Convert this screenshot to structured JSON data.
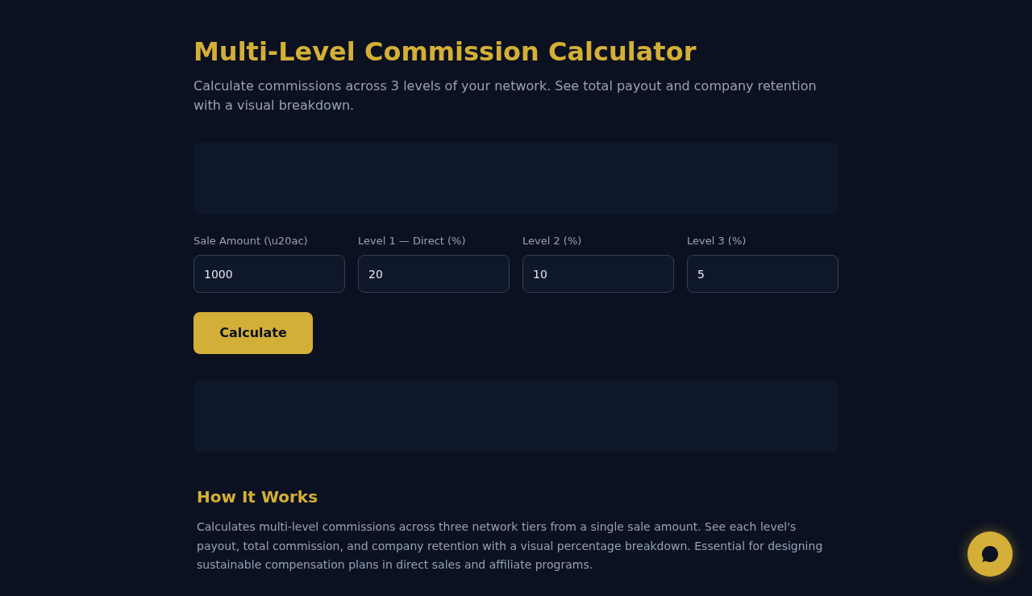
{
  "header": {
    "title": "Multi-Level Commission Calculator",
    "subtitle": "Calculate commissions across 3 levels of your network. See total payout and company retention with a visual breakdown."
  },
  "fields": [
    {
      "label": "Sale Amount (\\u20ac)",
      "value": "1000"
    },
    {
      "label": "Level 1 — Direct (%)",
      "value": "20"
    },
    {
      "label": "Level 2 (%)",
      "value": "10"
    },
    {
      "label": "Level 3 (%)",
      "value": "5"
    }
  ],
  "calculate_button": "Calculate",
  "how_it_works": {
    "heading": "How It Works",
    "text": "Calculates multi-level commissions across three network tiers from a single sale amount. See each level's payout, total commission, and company retention with a visual percentage breakdown. Essential for designing sustainable compensation plans in direct sales and affiliate programs."
  }
}
